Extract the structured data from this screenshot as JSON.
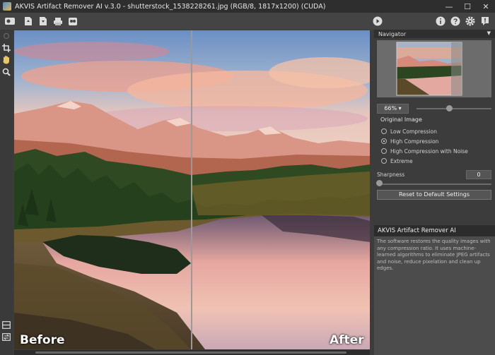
{
  "window": {
    "title": "AKVIS Artifact Remover AI v.3.0 - shutterstock_1538228261.jpg (RGB/8, 1817x1200) (CUDA)"
  },
  "window_controls": {
    "minimize": "—",
    "maximize": "☐",
    "close": "✕"
  },
  "canvas": {
    "before_label": "Before",
    "after_label": "After"
  },
  "navigator": {
    "title": "Navigator",
    "zoom_value": "66% ▾"
  },
  "settings": {
    "section_title": "Original Image",
    "options": [
      {
        "label": "Low Compression",
        "selected": false
      },
      {
        "label": "High Compression",
        "selected": true
      },
      {
        "label": "High Compression with Noise",
        "selected": false
      },
      {
        "label": "Extreme",
        "selected": false
      }
    ],
    "sharpness_label": "Sharpness",
    "sharpness_value": "0",
    "reset_label": "Reset to Default Settings"
  },
  "info": {
    "title": "AKVIS Artifact Remover AI",
    "text": "The software restores the quality images with any compression ratio. It uses machine-learned algorithms to eliminate JPEG artifacts and noise, reduce pixelation and clean up edges."
  },
  "colors": {
    "accent": "#4d8fd6",
    "panel_bg": "#3c3c3c"
  }
}
